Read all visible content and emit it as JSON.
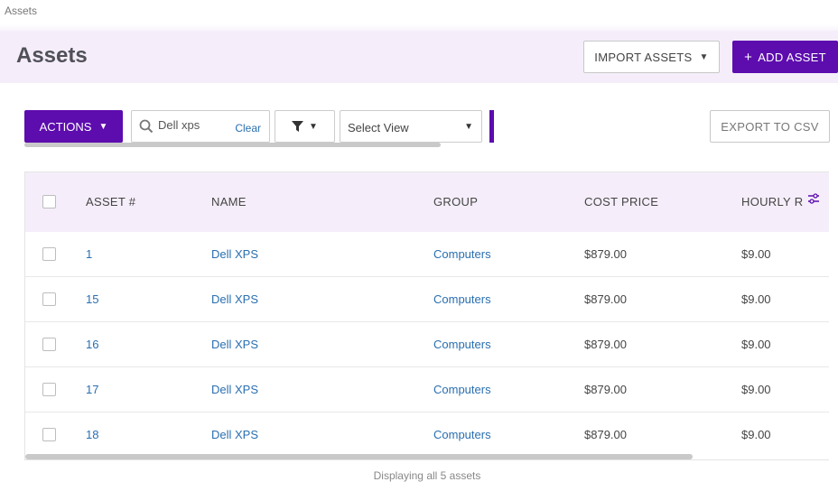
{
  "breadcrumb": "Assets",
  "header": {
    "title": "Assets",
    "import_label": "IMPORT ASSETS",
    "add_label": "ADD ASSET"
  },
  "toolbar": {
    "actions_label": "ACTIONS",
    "search_value": "Dell xps",
    "clear_label": "Clear",
    "select_view_label": "Select View",
    "export_label": "EXPORT TO CSV"
  },
  "table": {
    "columns": [
      "ASSET #",
      "NAME",
      "GROUP",
      "COST PRICE",
      "HOURLY R"
    ],
    "rows": [
      {
        "asset": "1",
        "name": "Dell XPS",
        "group": "Computers",
        "cost": "$879.00",
        "hourly": "$9.00"
      },
      {
        "asset": "15",
        "name": "Dell XPS",
        "group": "Computers",
        "cost": "$879.00",
        "hourly": "$9.00"
      },
      {
        "asset": "16",
        "name": "Dell XPS",
        "group": "Computers",
        "cost": "$879.00",
        "hourly": "$9.00"
      },
      {
        "asset": "17",
        "name": "Dell XPS",
        "group": "Computers",
        "cost": "$879.00",
        "hourly": "$9.00"
      },
      {
        "asset": "18",
        "name": "Dell XPS",
        "group": "Computers",
        "cost": "$879.00",
        "hourly": "$9.00"
      }
    ]
  },
  "footer": "Displaying all 5 assets",
  "colors": {
    "accent": "#5d0cae",
    "header_bg": "#f5eefa",
    "link": "#2a6fb0"
  },
  "icons": [
    "search-icon",
    "filter-icon",
    "chevron-down-icon",
    "column-settings-icon",
    "plus-icon"
  ]
}
